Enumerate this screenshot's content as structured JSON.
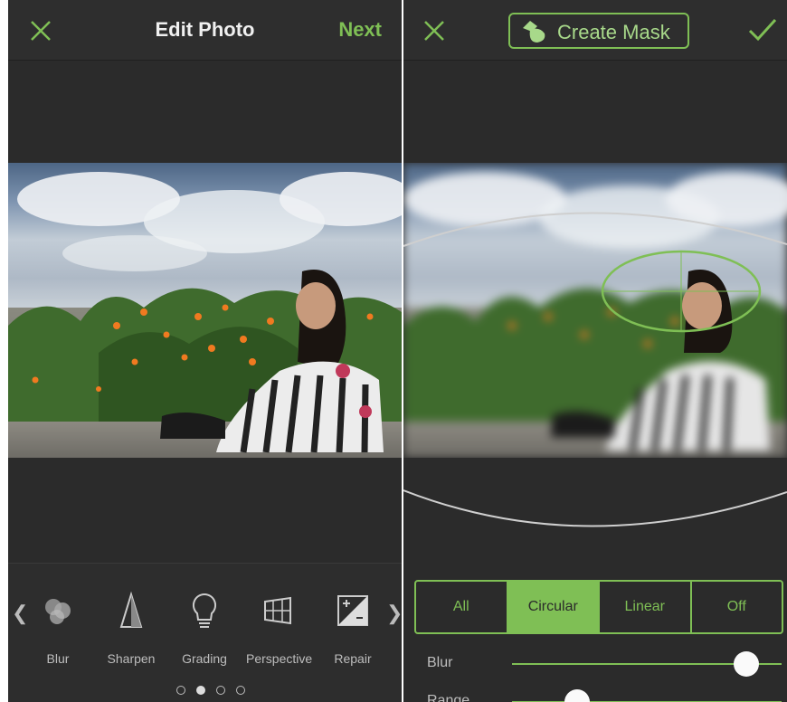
{
  "left": {
    "header": {
      "title": "Edit Photo",
      "next_label": "Next"
    },
    "tools": [
      {
        "label": "Blur",
        "icon": "blur-icon"
      },
      {
        "label": "Sharpen",
        "icon": "sharpen-icon"
      },
      {
        "label": "Grading",
        "icon": "grading-icon"
      },
      {
        "label": "Perspective",
        "icon": "perspective-icon"
      },
      {
        "label": "Repair",
        "icon": "repair-icon"
      }
    ],
    "page_indicator": {
      "total": 4,
      "active": 2
    }
  },
  "right": {
    "header": {
      "mask_label": "Create Mask"
    },
    "mask_modes": [
      "All",
      "Circular",
      "Linear",
      "Off"
    ],
    "active_mode": "Circular",
    "sliders": [
      {
        "label": "Blur",
        "value_fraction": 0.87
      },
      {
        "label": "Range",
        "value_fraction": 0.24
      }
    ]
  },
  "colors": {
    "accent": "#7fbf55",
    "background": "#2b2b2b"
  }
}
